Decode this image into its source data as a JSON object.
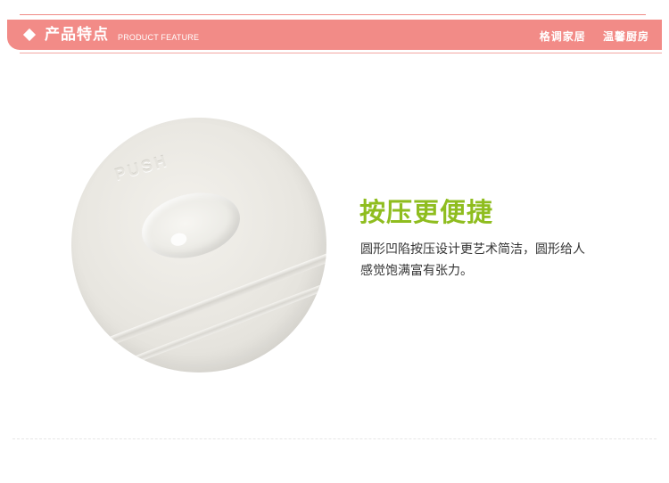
{
  "header": {
    "title": "产品特点",
    "subtitle": "PRODUCT FEATURE",
    "slogan_left": "格调家居",
    "slogan_right": "温馨厨房",
    "accent_color": "#f28b87"
  },
  "product_image": {
    "embossed_text": "PUSH"
  },
  "feature": {
    "heading": "按压更便捷",
    "heading_color": "#8fbd1f",
    "description_lines": [
      "圆形凹陷按压设计更艺术简洁，圆形给人",
      "感觉饱满富有张力。"
    ]
  }
}
